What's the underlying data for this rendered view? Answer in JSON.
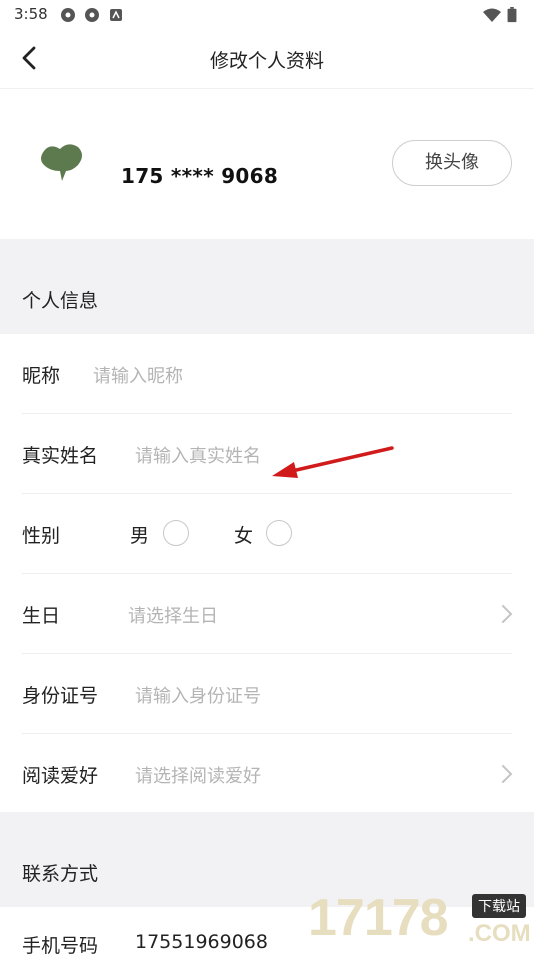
{
  "status_bar": {
    "time": "3:58"
  },
  "header": {
    "title": "修改个人资料"
  },
  "profile": {
    "phone_masked": "175 **** 9068",
    "change_avatar_label": "换头像"
  },
  "personal_section": {
    "title": "个人信息",
    "nickname": {
      "label": "昵称",
      "placeholder": "请输入昵称"
    },
    "real_name": {
      "label": "真实姓名",
      "placeholder": "请输入真实姓名"
    },
    "gender": {
      "label": "性别",
      "options": [
        "男",
        "女"
      ]
    },
    "birthday": {
      "label": "生日",
      "placeholder": "请选择生日"
    },
    "id_number": {
      "label": "身份证号",
      "placeholder": "请输入身份证号"
    },
    "reading_hobby": {
      "label": "阅读爱好",
      "placeholder": "请选择阅读爱好"
    }
  },
  "contact_section": {
    "title": "联系方式",
    "mobile": {
      "label": "手机号码",
      "value": "17551969068"
    }
  },
  "watermark": {
    "text": "17178",
    "badge": "下载站",
    "domain": ".COM"
  },
  "colors": {
    "avatar": "#5d7a4e",
    "arrow": "#d11a1a",
    "watermark": "#d9c99a"
  }
}
